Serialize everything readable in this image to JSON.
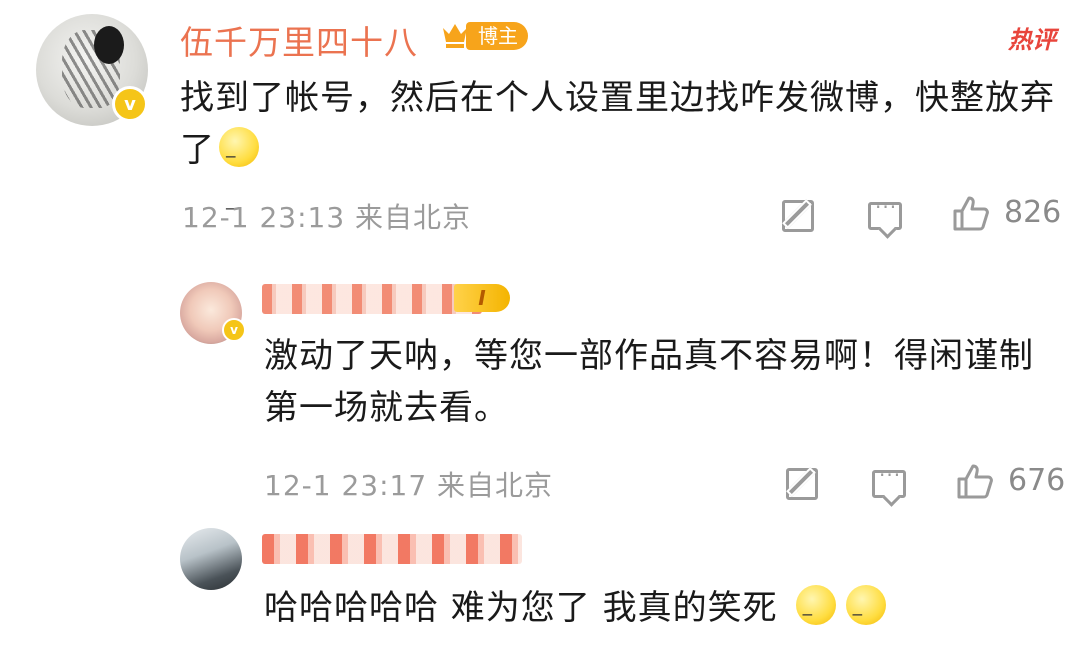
{
  "main_comment": {
    "username": "伍千万里四十八",
    "badge_label": "博主",
    "hot_tag": "热评",
    "text": "找到了帐号，然后在个人设置里边找咋发微博，快整放弃了",
    "time": "12-1 23:13",
    "location": "来自北京",
    "like_count": "826"
  },
  "replies": [
    {
      "level": "I",
      "text": "激动了天呐，等您一部作品真不容易啊！得闲谨制第一场就去看。",
      "time": "12-1 23:17",
      "location": "来自北京",
      "like_count": "676"
    },
    {
      "text": "哈哈哈哈哈 难为您了 我真的笑死"
    }
  ],
  "icons": {
    "edit": "edit-icon",
    "comment": "comment-icon",
    "like": "like-icon"
  }
}
